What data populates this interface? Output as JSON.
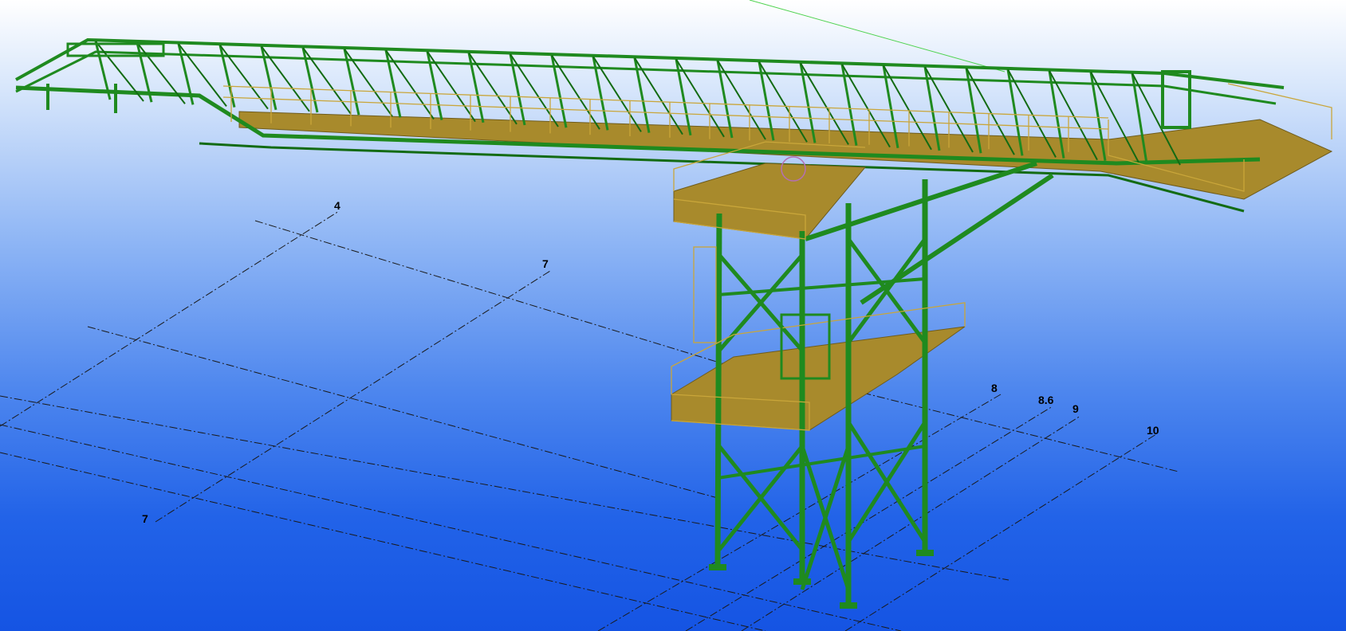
{
  "viewport": {
    "background_top": "#ffffff",
    "background_bottom": "#1554e3",
    "steel_color": "#1f8a1f",
    "deck_color": "#a88a2c",
    "handrail_color": "#c9a63a"
  },
  "grid_labels": {
    "g4": "4",
    "g7_top": "7",
    "g7_left": "7",
    "g8": "8",
    "g8_6": "8.6",
    "g9": "9",
    "g10": "10"
  }
}
